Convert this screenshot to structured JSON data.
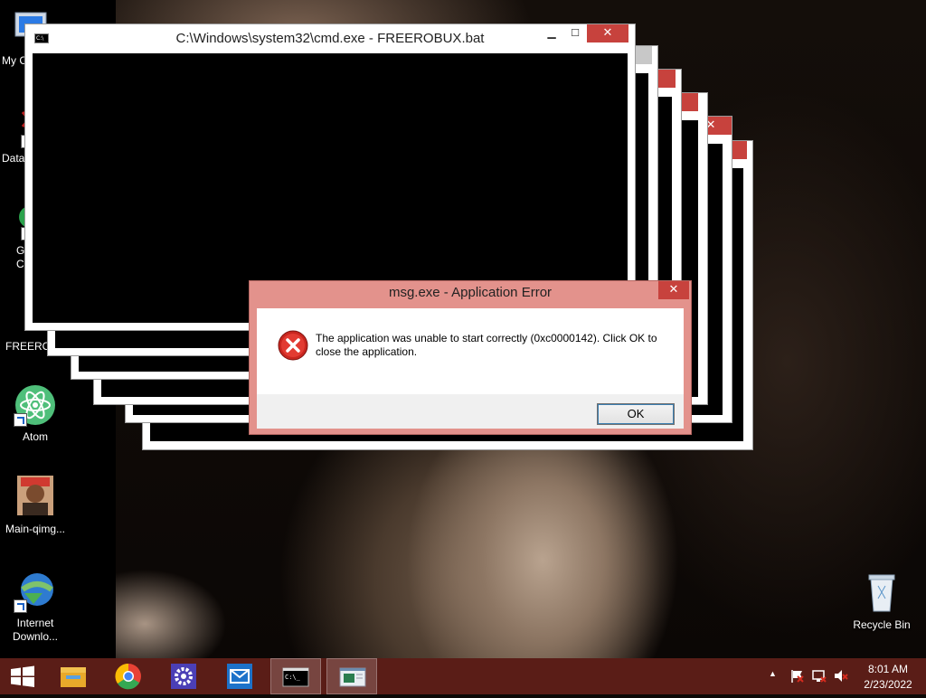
{
  "desktop": {
    "icons": [
      {
        "label": "My C"
      },
      {
        "label": "Data"
      },
      {
        "label": "G"
      },
      {
        "label": "C"
      },
      {
        "label": "FREEROB"
      },
      {
        "label": "Atom"
      },
      {
        "label": "Main-qimg..."
      },
      {
        "label": "Internet Downlo..."
      },
      {
        "label": "Recycle Bin"
      }
    ]
  },
  "cmd_window": {
    "title": "C:\\Windows\\system32\\cmd.exe - FREEROBUX.bat",
    "icon": "console-icon",
    "minimize_label": "▁",
    "maximize_label": "☐",
    "close_label": "✕"
  },
  "stack_windows": {
    "close_label": "✕",
    "maximize_label": "☐"
  },
  "error_dialog": {
    "title": "msg.exe - Application Error",
    "message": "The application was unable to start correctly (0xc0000142). Click OK to close the application.",
    "ok_label": "OK",
    "icon": "error-icon",
    "close_label": "✕"
  },
  "taskbar": {
    "items": [
      {
        "name": "file-explorer",
        "icon": "folder-icon"
      },
      {
        "name": "chrome",
        "icon": "chrome-icon"
      },
      {
        "name": "settings",
        "icon": "gear-icon"
      },
      {
        "name": "mail",
        "icon": "mail-icon"
      },
      {
        "name": "cmd",
        "icon": "console-icon"
      },
      {
        "name": "msg",
        "icon": "window-icon"
      }
    ],
    "tray": {
      "chevron": "▲",
      "time": "8:01 AM",
      "date": "2/23/2022"
    }
  },
  "colors": {
    "taskbar": "#5a1d17",
    "dialog_frame": "#e3928c",
    "close_button": "#c7423d"
  }
}
